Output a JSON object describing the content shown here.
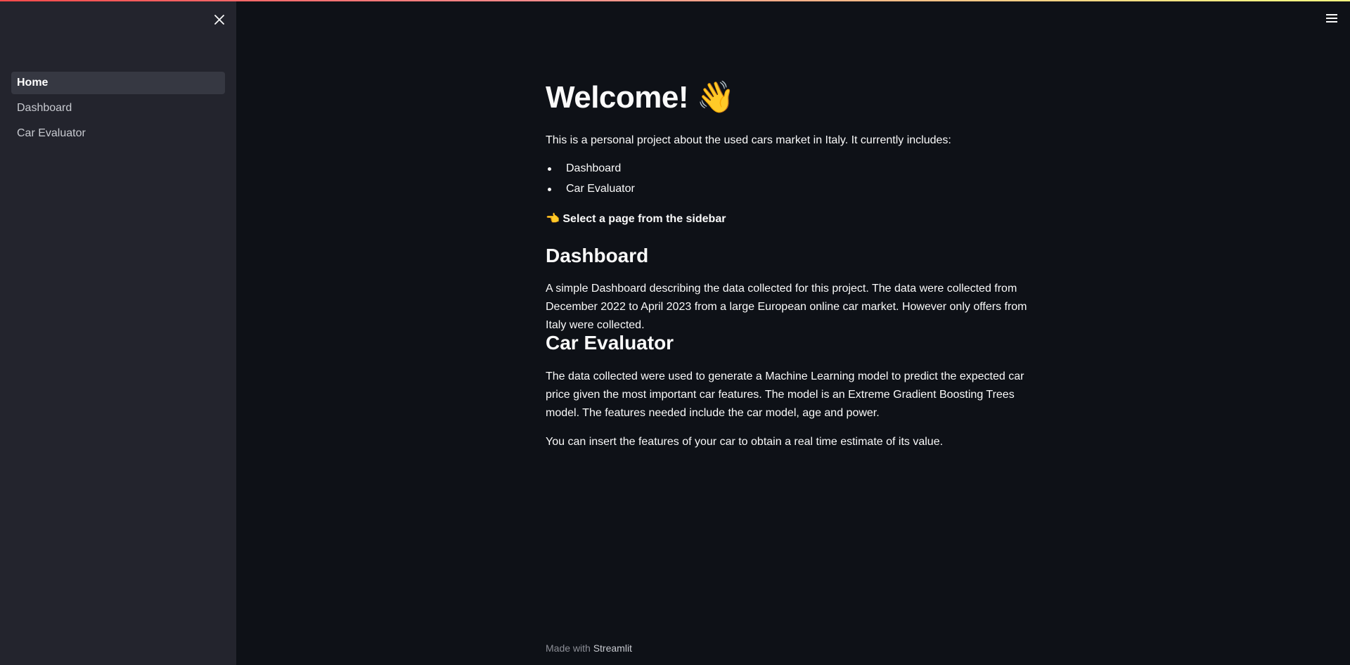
{
  "sidebar": {
    "items": [
      {
        "label": "Home",
        "active": true
      },
      {
        "label": "Dashboard",
        "active": false
      },
      {
        "label": "Car Evaluator",
        "active": false
      }
    ]
  },
  "main": {
    "title": "Welcome! 👋",
    "intro": "This is a personal project about the used cars market in Italy. It currently includes:",
    "features": [
      "Dashboard",
      "Car Evaluator"
    ],
    "select_hint": "👈 Select a page from the sidebar",
    "dashboard": {
      "heading": "Dashboard",
      "description": "A simple Dashboard describing the data collected for this project. The data were collected from December 2022 to April 2023 from a large European online car market. However only offers from Italy were collected."
    },
    "evaluator": {
      "heading": "Car Evaluator",
      "description": "The data collected were used to generate a Machine Learning model to predict the expected car price given the most important car features. The model is an Extreme Gradient Boosting Trees model. The features needed include the car model, age and power.",
      "note": "You can insert the features of your car to obtain a real time estimate of its value."
    }
  },
  "footer": {
    "prefix": "Made with",
    "brand": "Streamlit"
  },
  "colors": {
    "background": "#0e1117",
    "sidebar": "#23242d",
    "active_item": "#363842",
    "text": "#fafafa"
  },
  "icons": {
    "close": "close-icon",
    "menu": "hamburger-menu-icon"
  }
}
